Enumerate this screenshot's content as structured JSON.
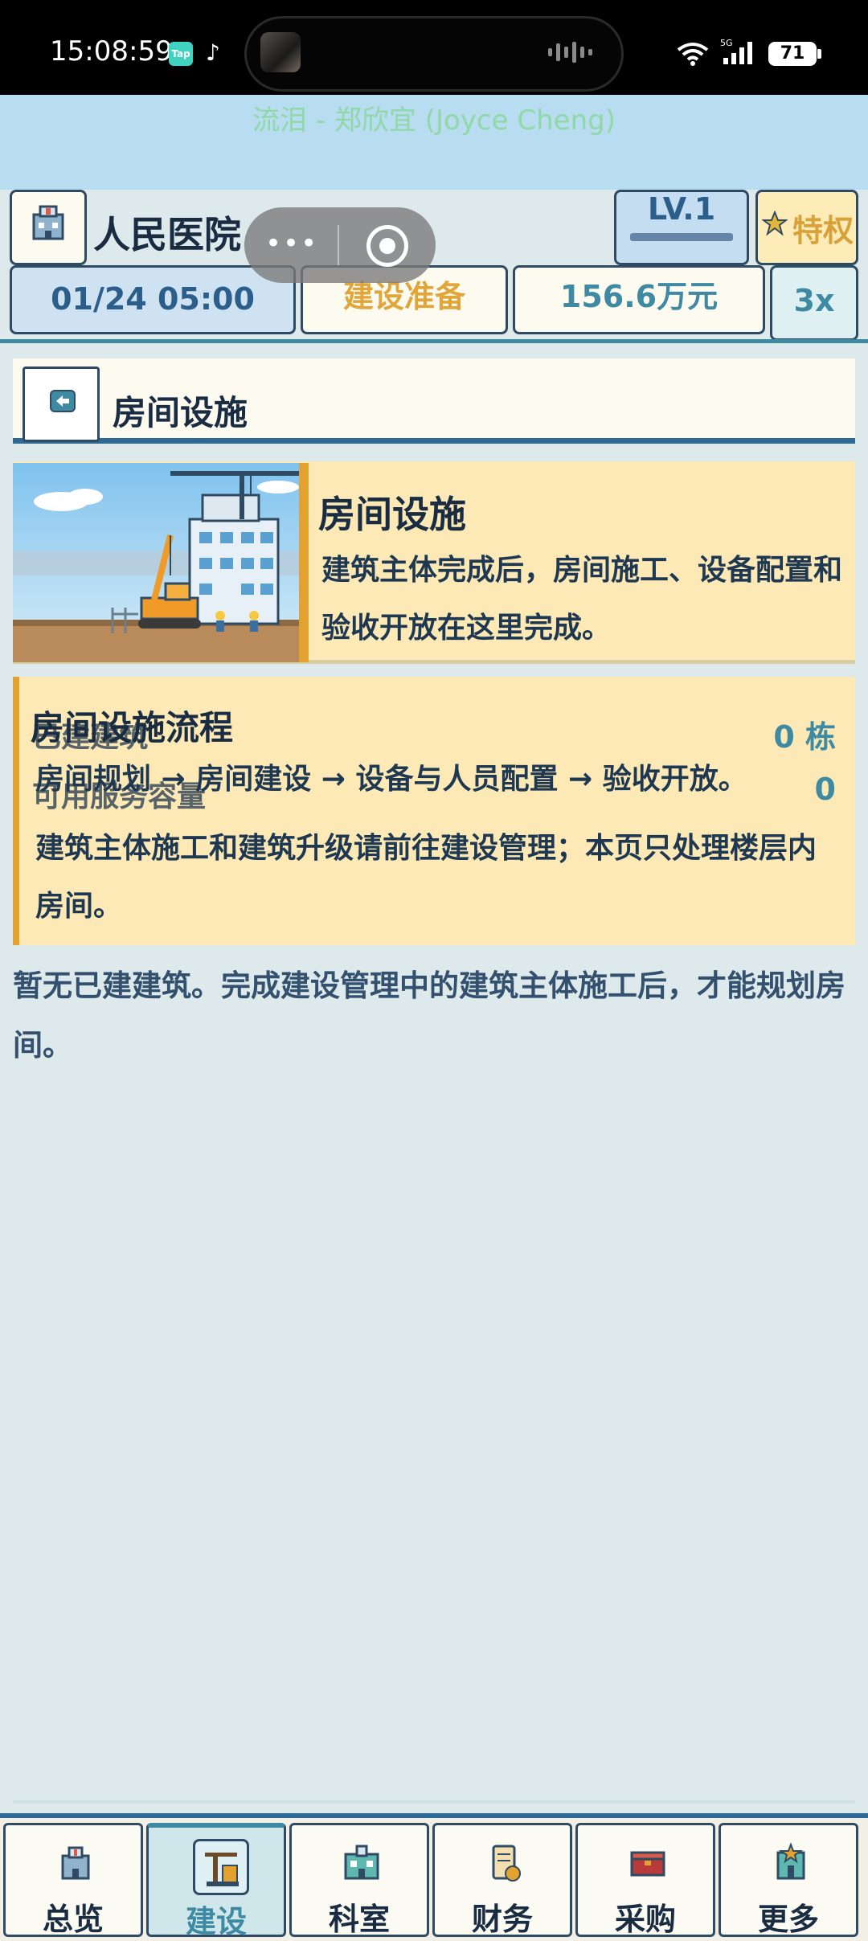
{
  "status_bar": {
    "time": "15:08:59",
    "tap_app": "Tap",
    "battery": "71"
  },
  "banner": {
    "song": "流泪 - 郑欣宜 (Joyce Cheng)"
  },
  "header": {
    "hospital_name": "人民医院",
    "level": "LV.1",
    "privilege": "特权",
    "date": "01/24 05:00",
    "status": "建设准备",
    "money": "156.6万元",
    "speed": "3x"
  },
  "page": {
    "title": "房间设施"
  },
  "intro": {
    "title": "房间设施",
    "description": "建筑主体完成后，房间施工、设备配置和验收开放在这里完成。"
  },
  "flow": {
    "title": "房间设施流程",
    "steps": "房间规划 → 房间建设 → 设备与人员配置 → 验收开放。",
    "note": "建筑主体施工和建筑升级请前往建设管理；本页只处理楼层内房间。",
    "stats": [
      {
        "label": "已建建筑",
        "value": "0 栋"
      },
      {
        "label": "可用服务容量",
        "value": "0"
      }
    ]
  },
  "empty_message": "暂无已建建筑。完成建设管理中的建筑主体施工后，才能规划房间。",
  "nav": {
    "items": [
      {
        "label": "总览",
        "icon": "hospital-icon"
      },
      {
        "label": "建设",
        "icon": "construction-icon",
        "active": true
      },
      {
        "label": "科室",
        "icon": "department-icon"
      },
      {
        "label": "财务",
        "icon": "finance-icon"
      },
      {
        "label": "采购",
        "icon": "purchase-icon"
      },
      {
        "label": "更多",
        "icon": "more-icon"
      }
    ]
  },
  "colors": {
    "accent": "#3e8aa3",
    "gold": "#e3a230",
    "navy": "#2f4b63"
  }
}
